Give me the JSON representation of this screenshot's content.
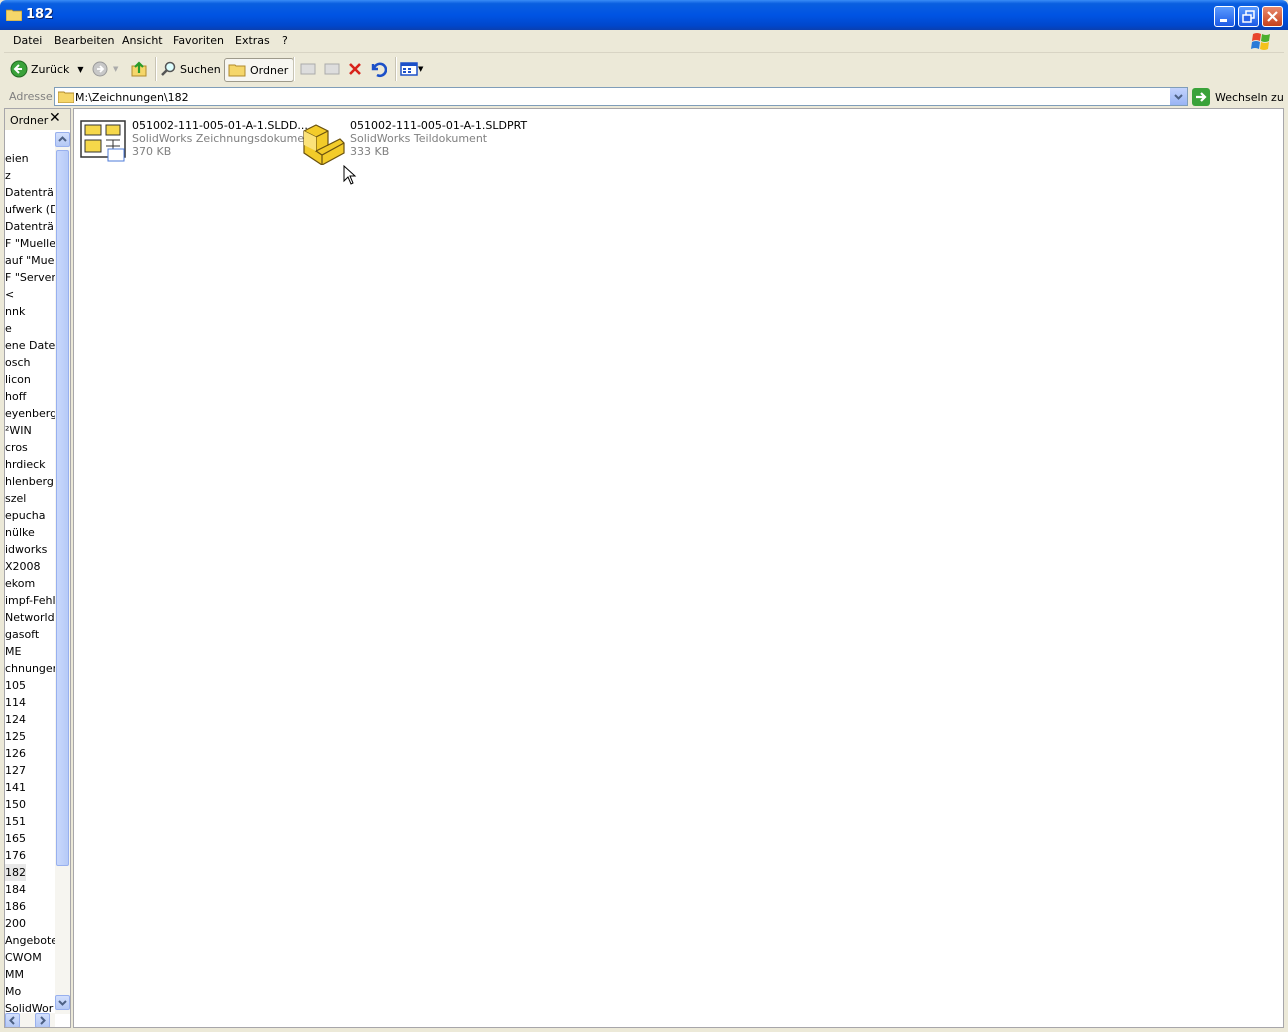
{
  "window": {
    "title": "182"
  },
  "menu": [
    "Datei",
    "Bearbeiten",
    "Ansicht",
    "Favoriten",
    "Extras",
    "?"
  ],
  "toolbar": {
    "back_label": "Zurück",
    "search_label": "Suchen",
    "folders_label": "Ordner"
  },
  "address": {
    "label": "Adresse",
    "path": "M:\\Zeichnungen\\182",
    "go_label": "Wechseln zu"
  },
  "folder_pane": {
    "title": "Ordner",
    "items": [
      "eien",
      "z",
      " Datenträ",
      "ufwerk (D",
      " Datenträ",
      "F \"Mueller_",
      "auf \"Muel",
      "F \"Server\"",
      "<",
      "nnk",
      "e",
      "ene Datei",
      "osch",
      "licon",
      "hoff",
      "eyenberg",
      "²WIN",
      "cros",
      "hrdieck",
      "hlenberg",
      "szel",
      "epucha",
      "nülke",
      "idworks",
      "X2008",
      "ekom",
      "impf-Fehle",
      "Networld",
      "gasoft",
      "ME",
      "chnungen",
      " 105",
      " 114",
      " 124",
      " 125",
      " 126",
      " 127",
      " 141",
      " 150",
      " 151",
      " 165",
      " 176",
      " 182",
      " 184",
      " 186",
      " 200",
      " Angebote",
      " CWOM",
      " MM",
      " Mo",
      " SolidWor"
    ],
    "selected": " 182"
  },
  "files": [
    {
      "name": "051002-111-005-01-A-1.SLDD...",
      "type": "SolidWorks Zeichnungsdokument",
      "size": "370 KB",
      "icon": "solidworks-drawing-icon"
    },
    {
      "name": "051002-111-005-01-A-1.SLDPRT",
      "type": "SolidWorks Teildokument",
      "size": "333 KB",
      "icon": "solidworks-part-icon"
    }
  ]
}
